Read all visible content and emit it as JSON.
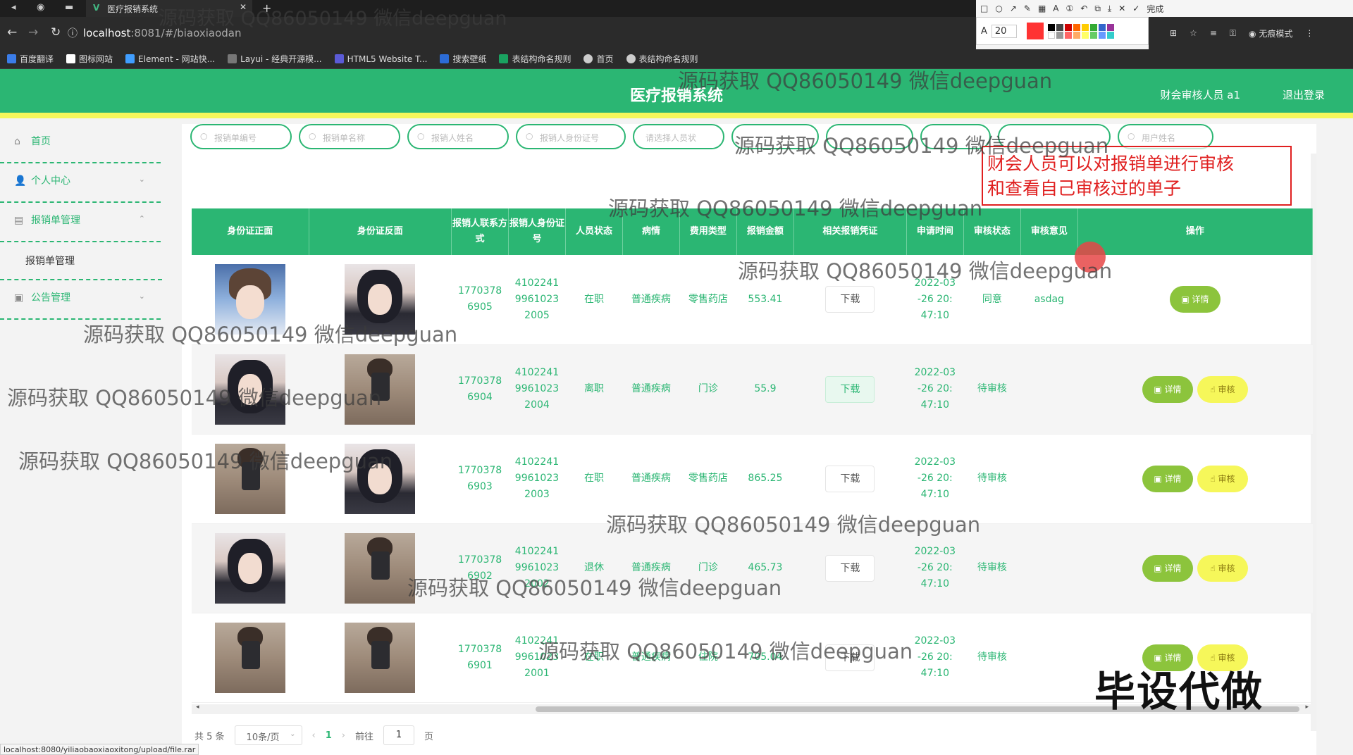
{
  "browser": {
    "tab_title": "医疗报销系统",
    "url_host": "localhost",
    "url_path": ":8081/#/biaoxiaodan",
    "bookmarks": [
      "百度翻译",
      "图标网站",
      "Element - 网站快...",
      "Layui - 经典开源模...",
      "HTML5 Website T...",
      "搜索壁纸",
      "表结构命名规则",
      "首页",
      "表结构命名规则"
    ],
    "profile_label": "无痕模式",
    "done_label": "完成",
    "pen_size": "20",
    "status_url": "localhost:8080/yiliaobaoxiaoxitong/upload/file.rar"
  },
  "header": {
    "title": "医疗报销系统",
    "user": "财会审核人员 a1",
    "logout": "退出登录"
  },
  "sidebar": {
    "items": [
      {
        "label": "首页",
        "icon": "home-icon"
      },
      {
        "label": "个人中心",
        "icon": "user-icon"
      },
      {
        "label": "报销单管理",
        "icon": "form-icon"
      },
      {
        "label": "公告管理",
        "icon": "notice-icon"
      }
    ],
    "submenu": "报销单管理"
  },
  "search": {
    "placeholders": [
      "报销单编号",
      "报销单名称",
      "报销人姓名",
      "报销人身份证号",
      "请选择人员状",
      "",
      "",
      "",
      "用户姓名"
    ]
  },
  "annotation": {
    "line1": "财会人员可以对报销单进行审核",
    "line2": "和查看自己审核过的单子"
  },
  "table": {
    "headers": [
      "身份证正面",
      "身份证反面",
      "报销人联系方式",
      "报销人身份证号",
      "人员状态",
      "病情",
      "费用类型",
      "报销金额",
      "相关报销凭证",
      "申请时间",
      "审核状态",
      "审核意见",
      "操作"
    ],
    "download_label": "下载",
    "detail_label": "详情",
    "audit_label": "审核",
    "rows": [
      {
        "front": "cartoon",
        "back": "girl",
        "phone": "17703786905",
        "idcard": "410224199610232005",
        "status": "在职",
        "illness": "普通疾病",
        "fee_type": "零售药店",
        "amount": "553.41",
        "time": "2022-03-26 20:47:10",
        "audit_status": "同意",
        "opinion": "asdag",
        "can_audit": false
      },
      {
        "front": "girl",
        "back": "boy",
        "phone": "17703786904",
        "idcard": "410224199610232004",
        "status": "离职",
        "illness": "普通疾病",
        "fee_type": "门诊",
        "amount": "55.9",
        "time": "2022-03-26 20:47:10",
        "audit_status": "待审核",
        "opinion": "",
        "can_audit": true
      },
      {
        "front": "boy",
        "back": "girl",
        "phone": "17703786903",
        "idcard": "410224199610232003",
        "status": "在职",
        "illness": "普通疾病",
        "fee_type": "零售药店",
        "amount": "865.25",
        "time": "2022-03-26 20:47:10",
        "audit_status": "待审核",
        "opinion": "",
        "can_audit": true
      },
      {
        "front": "girl",
        "back": "boy",
        "phone": "17703786902",
        "idcard": "410224199610232002",
        "status": "退休",
        "illness": "普通疾病",
        "fee_type": "门诊",
        "amount": "465.73",
        "time": "2022-03-26 20:47:10",
        "audit_status": "待审核",
        "opinion": "",
        "can_audit": true
      },
      {
        "front": "boy",
        "back": "boy",
        "phone": "17703786901",
        "idcard": "410224199610232001",
        "status": "在职",
        "illness": "普通疾病",
        "fee_type": "住院",
        "amount": "705.04",
        "time": "2022-03-26 20:47:10",
        "audit_status": "待审核",
        "opinion": "",
        "can_audit": true
      }
    ]
  },
  "pagination": {
    "total": "共 5 条",
    "page_size": "10条/页",
    "current": "1",
    "goto_prefix": "前往",
    "goto_value": "1",
    "goto_suffix": "页"
  },
  "overlay": {
    "watermark": "源码获取 QQ86050149 微信deepguan",
    "stamp": "毕设代做"
  },
  "colors": {
    "primary": "#2bb673",
    "accent_yellow": "#f6f75a",
    "detail_green": "#8cc43c",
    "annotation_red": "#e02020"
  }
}
